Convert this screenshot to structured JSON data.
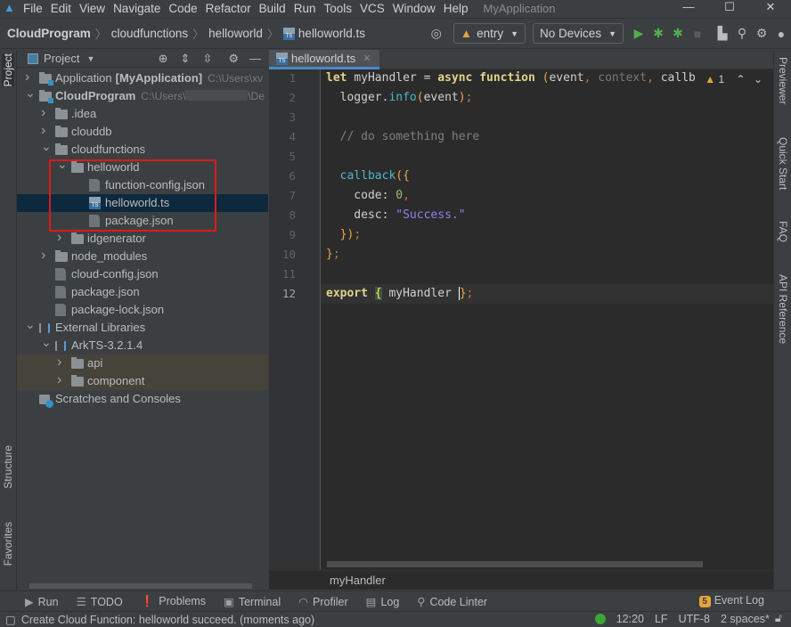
{
  "menu": {
    "items": [
      "File",
      "Edit",
      "View",
      "Navigate",
      "Code",
      "Refactor",
      "Build",
      "Run",
      "Tools",
      "VCS",
      "Window",
      "Help"
    ],
    "title": "MyApplication"
  },
  "window_controls": [
    "—",
    "☐",
    "✕"
  ],
  "breadcrumb": [
    "CloudProgram",
    "cloudfunctions",
    "helloworld",
    "helloworld.ts"
  ],
  "toolbar": {
    "config": "entry",
    "device": "No Devices"
  },
  "project_panel": {
    "title": "Project",
    "tree": [
      {
        "label": "Application",
        "extra": "[MyApplication]",
        "path": "C:\\Users\\xv",
        "level": 0,
        "arrow": "right",
        "icon": "module"
      },
      {
        "label": "CloudProgram",
        "path": "C:\\Users\\",
        "path_end": "\\De",
        "level": 0,
        "arrow": "down",
        "icon": "module",
        "bold": true
      },
      {
        "label": ".idea",
        "level": 1,
        "arrow": "right",
        "icon": "folder"
      },
      {
        "label": "clouddb",
        "level": 1,
        "arrow": "right",
        "icon": "folder"
      },
      {
        "label": "cloudfunctions",
        "level": 1,
        "arrow": "down",
        "icon": "folder"
      },
      {
        "label": "helloworld",
        "level": 2,
        "arrow": "down",
        "icon": "folder"
      },
      {
        "label": "function-config.json",
        "level": 3,
        "icon": "json"
      },
      {
        "label": "helloworld.ts",
        "level": 3,
        "icon": "ts",
        "selected": true
      },
      {
        "label": "package.json",
        "level": 3,
        "icon": "json"
      },
      {
        "label": "idgenerator",
        "level": 2,
        "arrow": "right",
        "icon": "folder"
      },
      {
        "label": "node_modules",
        "level": 1,
        "arrow": "right",
        "icon": "folder"
      },
      {
        "label": "cloud-config.json",
        "level": 1,
        "icon": "json",
        "noarrow": true
      },
      {
        "label": "package.json",
        "level": 1,
        "icon": "json",
        "noarrow": true
      },
      {
        "label": "package-lock.json",
        "level": 1,
        "icon": "json",
        "noarrow": true
      },
      {
        "label": "External Libraries",
        "level": 0,
        "arrow": "down",
        "icon": "lib"
      },
      {
        "label": "ArkTS-3.2.1.4",
        "level": 1,
        "arrow": "down",
        "icon": "lib"
      },
      {
        "label": "api",
        "level": 2,
        "arrow": "right",
        "icon": "folder",
        "lib": true
      },
      {
        "label": "component",
        "level": 2,
        "arrow": "right",
        "icon": "folder",
        "lib": true
      },
      {
        "label": "Scratches and Consoles",
        "level": 0,
        "icon": "scratch",
        "noarrow": true
      }
    ]
  },
  "editor": {
    "tab": "helloworld.ts",
    "warnings": "1",
    "current_line": 12,
    "lines": [
      [
        [
          "let ",
          "kw"
        ],
        [
          "myHandler = ",
          "pa"
        ],
        [
          "async ",
          "kw"
        ],
        [
          "function ",
          "kw"
        ],
        [
          "(",
          "br"
        ],
        [
          "event",
          "pa"
        ],
        [
          ", ",
          "pn"
        ],
        [
          "context",
          "gr"
        ],
        [
          ", ",
          "pn"
        ],
        [
          "callb",
          "pa"
        ]
      ],
      [
        [
          "  logger.",
          "pa"
        ],
        [
          "info",
          "fn"
        ],
        [
          "(",
          "br"
        ],
        [
          "event",
          "pa"
        ],
        [
          ")",
          "br"
        ],
        [
          ";",
          "pn"
        ]
      ],
      [],
      [
        [
          "  // do something here",
          "cm"
        ]
      ],
      [],
      [
        [
          "  ",
          "pa"
        ],
        [
          "callback",
          "fn"
        ],
        [
          "(",
          "br"
        ],
        [
          "{",
          "br"
        ]
      ],
      [
        [
          "    code: ",
          "pa"
        ],
        [
          "0",
          "nu"
        ],
        [
          ",",
          "pn"
        ]
      ],
      [
        [
          "    desc: ",
          "pa"
        ],
        [
          "\"Success.\"",
          "st"
        ]
      ],
      [
        [
          "  ",
          "pa"
        ],
        [
          "}",
          "br"
        ],
        [
          ")",
          "br"
        ],
        [
          ";",
          "pn"
        ]
      ],
      [
        [
          "}",
          "br"
        ],
        [
          ";",
          "pn"
        ]
      ],
      [],
      [
        [
          "export ",
          "kw"
        ],
        [
          "{",
          "hl"
        ],
        [
          " myHandler ",
          "pa"
        ],
        [
          "}",
          "caret br"
        ],
        [
          ";",
          "pn"
        ]
      ]
    ],
    "crumb": "myHandler"
  },
  "left_strip": [
    "Project",
    "Structure",
    "Favorites"
  ],
  "right_strip": [
    "Previewer",
    "Quick Start",
    "FAQ",
    "API Reference"
  ],
  "tool_windows": [
    {
      "icon": "▶",
      "label": "Run"
    },
    {
      "icon": "☰",
      "label": "TODO"
    },
    {
      "icon": "❗",
      "label": "Problems"
    },
    {
      "icon": "▣",
      "label": "Terminal"
    },
    {
      "icon": "◠",
      "label": "Profiler"
    },
    {
      "icon": "▤",
      "label": "Log"
    },
    {
      "icon": "⚲",
      "label": "Code Linter"
    }
  ],
  "event_log": {
    "badge": "5",
    "label": "Event Log"
  },
  "status": {
    "message": "Create Cloud Function: helloworld succeed. (moments ago)",
    "position": "12:20",
    "line_sep": "LF",
    "encoding": "UTF-8",
    "indent": "2 spaces*"
  },
  "colors": {
    "accent": "#4a88c7",
    "highlight_box": "#e01818",
    "selection": "#0d293e"
  }
}
